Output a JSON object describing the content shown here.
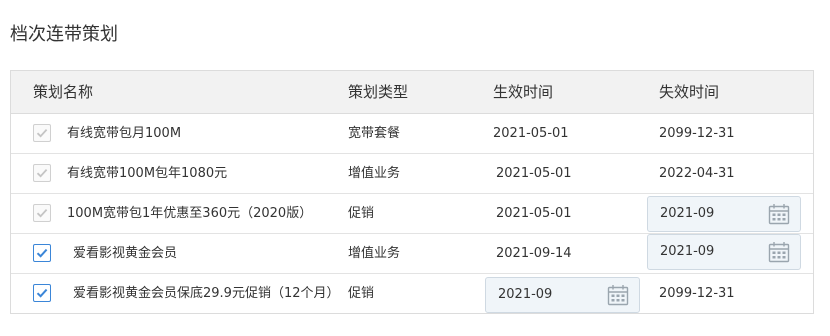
{
  "page": {
    "title": "档次连带策划"
  },
  "table": {
    "columns": [
      "策划名称",
      "策划类型",
      "生效时间",
      "失效时间"
    ],
    "rows": [
      {
        "checked": true,
        "disabled": true,
        "name": "有线宽带包月100M",
        "type": "宽带套餐",
        "start": "2021-05-01",
        "end": "2099-12-31",
        "end_editable": false
      },
      {
        "checked": true,
        "disabled": true,
        "name": "有线宽带100M包年1080元",
        "type": "增值业务",
        "start": "2021-05-01",
        "end": "2022-04-31",
        "end_editable": false
      },
      {
        "checked": true,
        "disabled": true,
        "name": "100M宽带包1年优惠至360元（2020版）",
        "type": "促销",
        "start": "2021-05-01",
        "end": "2021-09",
        "end_editable": true
      },
      {
        "checked": true,
        "disabled": false,
        "name": "爱看影视黄金会员",
        "type": "增值业务",
        "start": "2021-09-14",
        "end": "2021-09",
        "end_editable": true
      },
      {
        "checked": true,
        "disabled": false,
        "name": "爱看影视黄金会员保底29.9元促销（12个月）",
        "type": "促销",
        "start": "2021-09",
        "end": "2099-12-31",
        "end_editable": false,
        "start_editable": true
      }
    ]
  },
  "icons": {
    "checkbox": "check-icon",
    "date": "calendar-icon"
  },
  "colors": {
    "accent": "#3b86d8",
    "disabled_check": "#c4c4c4",
    "header_bg": "#f2f2f2",
    "date_bg": "#f0f5f9"
  }
}
